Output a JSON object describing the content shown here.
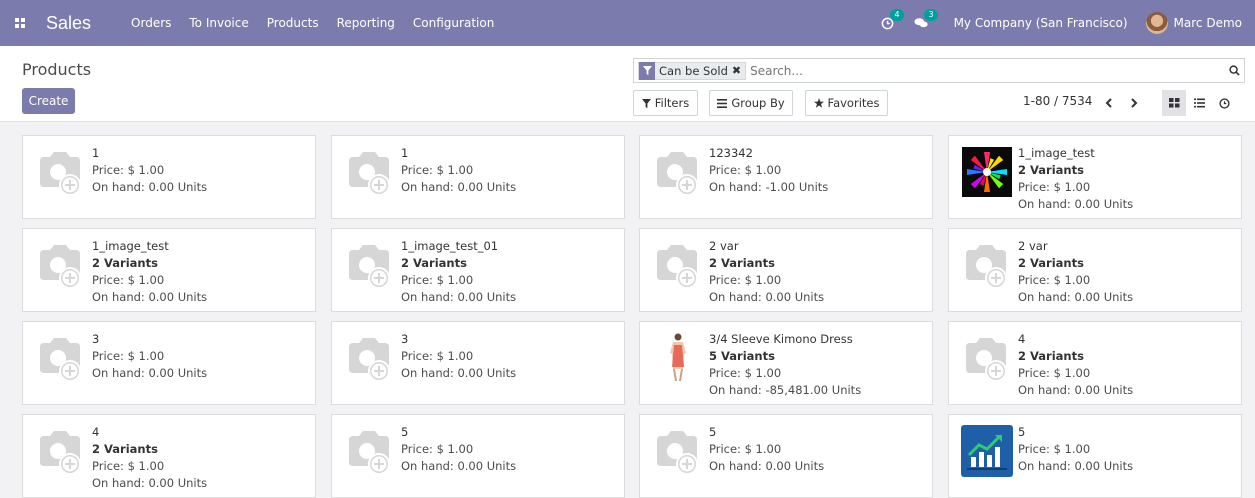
{
  "navbar": {
    "app_name": "Sales",
    "menu": [
      "Orders",
      "To Invoice",
      "Products",
      "Reporting",
      "Configuration"
    ],
    "activity_badge": "4",
    "messages_badge": "3",
    "company": "My Company (San Francisco)",
    "user": "Marc Demo",
    "bg_color": "#7c7bad"
  },
  "control": {
    "title": "Products",
    "create_label": "Create",
    "facet_label": "Can be Sold",
    "facet_close": "✖",
    "search_placeholder": "Search...",
    "filters_label": "Filters",
    "groupby_label": "Group By",
    "favorites_label": "Favorites",
    "pager": "1-80 / 7534"
  },
  "cards": [
    {
      "name": "1",
      "variants": "",
      "price": "Price: $ 1.00",
      "onhand": "On hand: 0.00 Units",
      "image": "placeholder"
    },
    {
      "name": "1",
      "variants": "",
      "price": "Price: $ 1.00",
      "onhand": "On hand: 0.00 Units",
      "image": "placeholder"
    },
    {
      "name": "123342",
      "variants": "",
      "price": "Price: $ 1.00",
      "onhand": "On hand: -1.00 Units",
      "image": "placeholder"
    },
    {
      "name": "1_image_test",
      "variants": "2 Variants",
      "price": "Price: $ 1.00",
      "onhand": "On hand: 0.00 Units",
      "image": "splash"
    },
    {
      "name": "1_image_test",
      "variants": "2 Variants",
      "price": "Price: $ 1.00",
      "onhand": "On hand: 0.00 Units",
      "image": "placeholder"
    },
    {
      "name": "1_image_test_01",
      "variants": "2 Variants",
      "price": "Price: $ 1.00",
      "onhand": "On hand: 0.00 Units",
      "image": "placeholder"
    },
    {
      "name": "2 var",
      "variants": "2 Variants",
      "price": "Price: $ 1.00",
      "onhand": "On hand: 0.00 Units",
      "image": "placeholder"
    },
    {
      "name": "2 var",
      "variants": "2 Variants",
      "price": "Price: $ 1.00",
      "onhand": "On hand: 0.00 Units",
      "image": "placeholder"
    },
    {
      "name": "3",
      "variants": "",
      "price": "Price: $ 1.00",
      "onhand": "On hand: 0.00 Units",
      "image": "placeholder"
    },
    {
      "name": "3",
      "variants": "",
      "price": "Price: $ 1.00",
      "onhand": "On hand: 0.00 Units",
      "image": "placeholder"
    },
    {
      "name": "3/4 Sleeve Kimono Dress",
      "variants": "5 Variants",
      "price": "Price: $ 1.00",
      "onhand": "On hand: -85,481.00 Units",
      "image": "dress"
    },
    {
      "name": "4",
      "variants": "2 Variants",
      "price": "Price: $ 1.00",
      "onhand": "On hand: 0.00 Units",
      "image": "placeholder"
    },
    {
      "name": "4",
      "variants": "2 Variants",
      "price": "Price: $ 1.00",
      "onhand": "On hand: 0.00 Units",
      "image": "placeholder"
    },
    {
      "name": "5",
      "variants": "",
      "price": "Price: $ 1.00",
      "onhand": "On hand: 0.00 Units",
      "image": "placeholder"
    },
    {
      "name": "5",
      "variants": "",
      "price": "Price: $ 1.00",
      "onhand": "On hand: 0.00 Units",
      "image": "placeholder"
    },
    {
      "name": "5",
      "variants": "",
      "price": "Price: $ 1.00",
      "onhand": "On hand: 0.00 Units",
      "image": "chart"
    }
  ]
}
